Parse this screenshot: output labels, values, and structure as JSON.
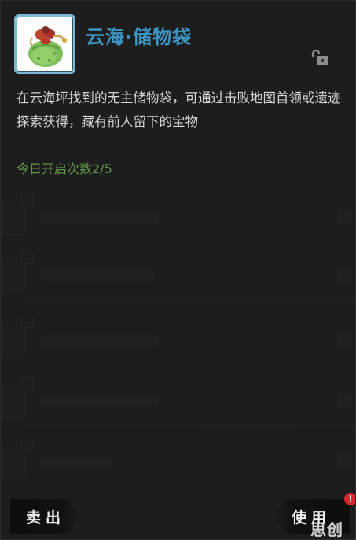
{
  "item": {
    "title": "云海·储物袋",
    "description": "在云海坪找到的无主储物袋，可通过击败地图首领或遗迹探索获得，藏有前人留下的宝物",
    "daily_open": "今日开启次数2/5"
  },
  "buttons": {
    "sell": "卖出",
    "use": "使用"
  },
  "badge": "!",
  "watermark": "思创网",
  "colors": {
    "title": "#3e94c0",
    "frame": "#79b9d8",
    "daily_text": "#5f9a49",
    "alert": "#d9262c"
  },
  "icons": {
    "item": "green-pouch-icon",
    "lock": "unlock-icon",
    "alert": "exclamation-badge-icon"
  }
}
